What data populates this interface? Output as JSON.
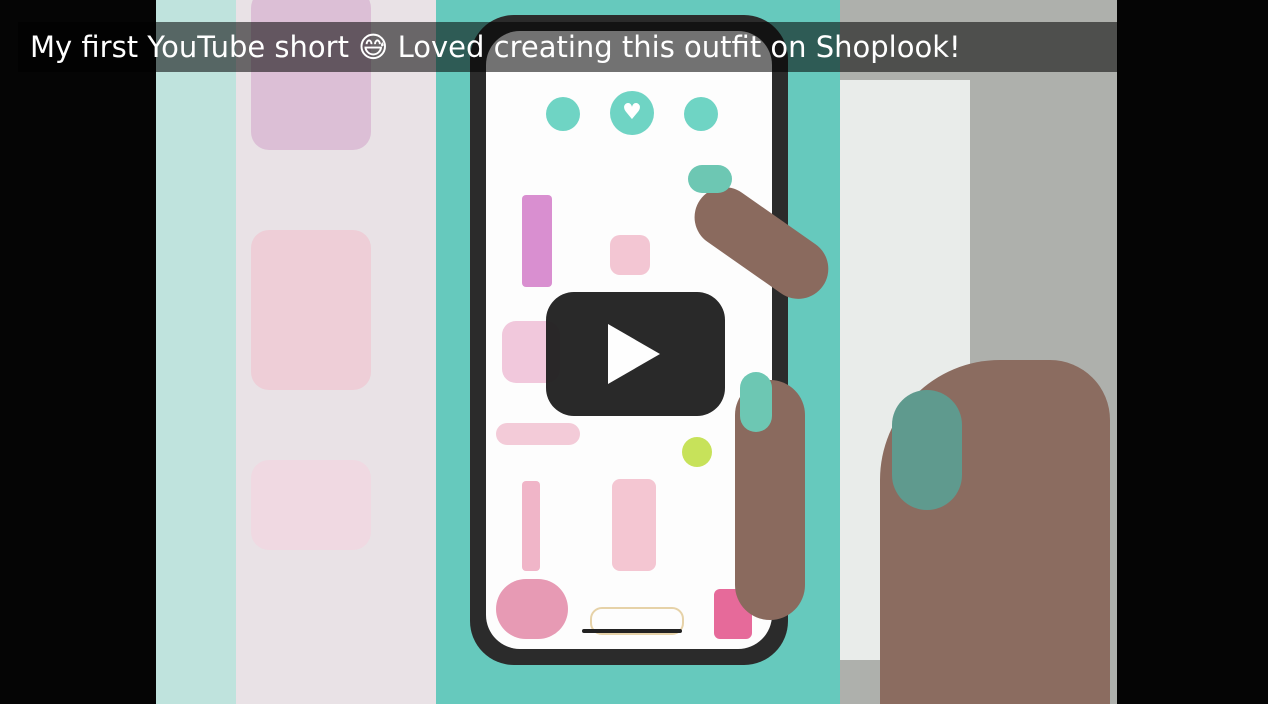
{
  "video": {
    "title": "My first YouTube short 😅 Loved creating this outfit on Shoplook!"
  },
  "colors": {
    "app_accent": "#6fd4c4",
    "play_button": "#212121",
    "backdrop_teal": "#66c9bd"
  },
  "icons": {
    "play": "play-icon",
    "heart": "heart-icon"
  }
}
